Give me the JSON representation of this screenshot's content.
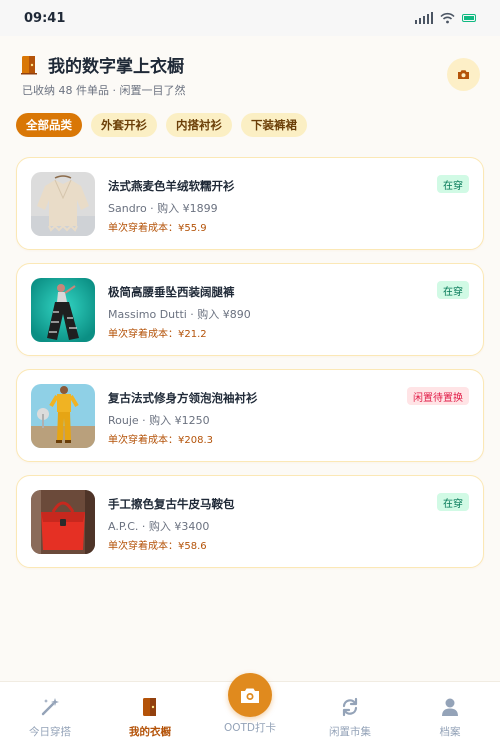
{
  "status_bar": {
    "time": "09:41"
  },
  "header": {
    "title": "我的数字掌上衣橱",
    "subtitle": "已收纳 48 件单品 · 闲置一目了然"
  },
  "filters": [
    "全部品类",
    "外套开衫",
    "内搭衬衫",
    "下装裤裙"
  ],
  "active_filter": "全部品类",
  "items": [
    {
      "name": "法式燕麦色羊绒软糯开衫",
      "meta": "Sandro · 购入 ¥1899",
      "cost": "单次穿着成本：¥55.9",
      "status": "在穿",
      "status_type": "wearing",
      "image": "cream-knit-cardigan"
    },
    {
      "name": "极简高腰垂坠西装阔腿裤",
      "meta": "Massimo Dutti · 购入 ¥890",
      "cost": "单次穿着成本：¥21.2",
      "status": "在穿",
      "status_type": "wearing",
      "image": "wide-leg-trousers-photo"
    },
    {
      "name": "复古法式修身方领泡泡袖衬衫",
      "meta": "Rouje · 购入 ¥1250",
      "cost": "单次穿着成本：¥208.3",
      "status": "闲置待置换",
      "status_type": "idle",
      "image": "yellow-outfit-photo"
    },
    {
      "name": "手工擦色复古牛皮马鞍包",
      "meta": "A.P.C. · 购入 ¥3400",
      "cost": "单次穿着成本：¥58.6",
      "status": "在穿",
      "status_type": "wearing",
      "image": "red-leather-handbag"
    }
  ],
  "tabbar": {
    "tabs": [
      {
        "label": "今日穿搭",
        "icon": "magic-wand-icon"
      },
      {
        "label": "我的衣橱",
        "icon": "wardrobe-icon"
      },
      {
        "label": "OOTD打卡",
        "icon": "camera-icon"
      },
      {
        "label": "闲置市集",
        "icon": "refresh-icon"
      },
      {
        "label": "档案",
        "icon": "user-icon"
      }
    ],
    "active": "我的衣橱"
  },
  "colors": {
    "accent": "#d97706",
    "chip_bg": "#fbefc4",
    "wearing": "#047857",
    "idle": "#e11d48"
  }
}
